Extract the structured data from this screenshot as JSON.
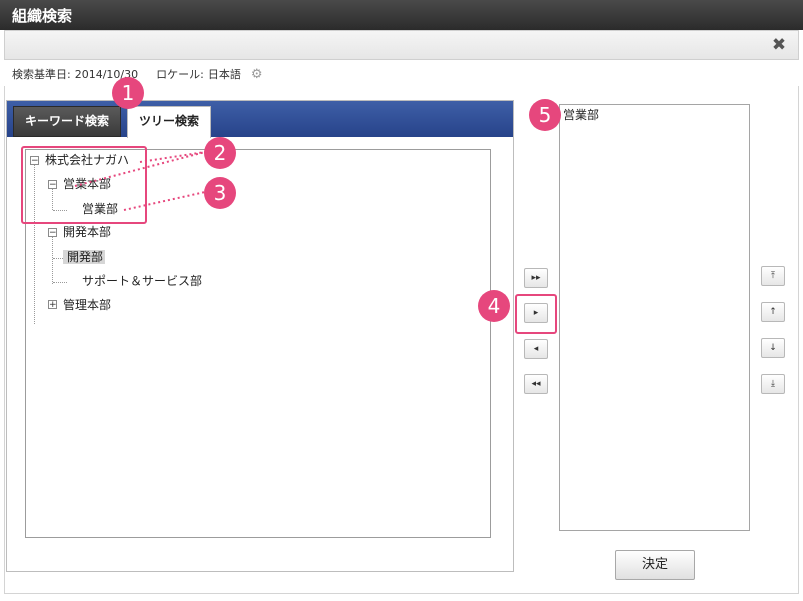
{
  "window": {
    "title": "組織検索",
    "close_icon": "✖"
  },
  "info": {
    "date_label": "検索基準日:",
    "date_value": "2014/10/30",
    "locale_label": "ロケール:",
    "locale_value": "日本語",
    "settings_icon": "⚙"
  },
  "tabs": {
    "keyword": "キーワード検索",
    "tree": "ツリー検索"
  },
  "tree": {
    "root": "株式会社ナガハ",
    "sales_hq": "営業本部",
    "sales_dept": "営業部",
    "dev_hq": "開発本部",
    "dev_dept": "開発部",
    "support_dept": "サポート＆サービス部",
    "admin_hq": "管理本部",
    "minus": "−",
    "plus": "+"
  },
  "move_buttons": {
    "add_all": "▸▸",
    "add": "▸",
    "remove": "◂",
    "remove_all": "◂◂"
  },
  "order_buttons": {
    "top": "⤒",
    "up": "↑",
    "down": "↓",
    "bottom": "⤓"
  },
  "selected_list": {
    "items": [
      "営業部"
    ]
  },
  "decide_button": "決定",
  "callouts": [
    "1",
    "2",
    "3",
    "4",
    "5"
  ],
  "annotation_color": "#e6477d"
}
